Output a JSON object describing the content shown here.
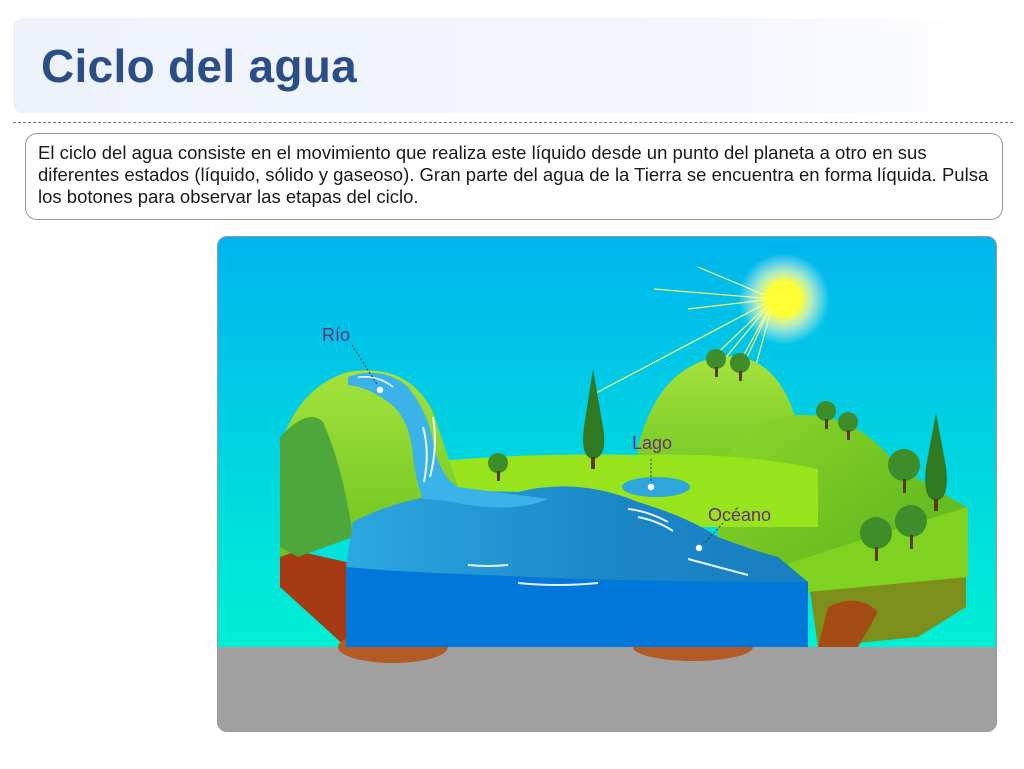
{
  "page": {
    "title": "Ciclo del agua",
    "intro": "El ciclo del agua consiste en el movimiento que realiza este líquido desde un punto del planeta a otro en sus diferentes estados (líquido, sólido y gaseoso). Gran parte del agua de la Tierra se encuentra en forma líquida. Pulsa los botones para observar las etapas del ciclo."
  },
  "diagram": {
    "labels": {
      "river": "Río",
      "lake": "Lago",
      "ocean": "Océano"
    },
    "icons": {
      "sun": "sun-icon",
      "hotspot": "hotspot-dot-icon"
    }
  },
  "colors": {
    "title": "#2c4e86",
    "label": "#6a2f74",
    "sky_top": "#00b5ee",
    "sky_bottom": "#00f0d4",
    "ground_band": "#a0a0a0"
  }
}
